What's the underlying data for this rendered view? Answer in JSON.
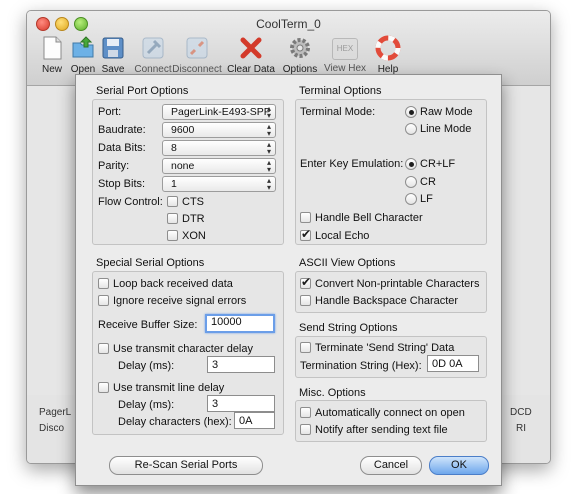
{
  "window": {
    "title": "CoolTerm_0",
    "toolbar": [
      {
        "id": "new",
        "label": "New",
        "icon": "new-document-icon"
      },
      {
        "id": "open",
        "label": "Open",
        "icon": "open-folder-icon"
      },
      {
        "id": "save",
        "label": "Save",
        "icon": "save-disk-icon"
      },
      {
        "id": "connect",
        "label": "Connect",
        "icon": "connect-plug-icon"
      },
      {
        "id": "disconnect",
        "label": "Disconnect",
        "icon": "disconnect-plug-icon"
      },
      {
        "id": "clear",
        "label": "Clear Data",
        "icon": "clear-x-icon"
      },
      {
        "id": "options",
        "label": "Options",
        "icon": "gear-icon"
      },
      {
        "id": "hex",
        "label": "View Hex",
        "icon": "hex-icon",
        "glyph": "HEX"
      },
      {
        "id": "help",
        "label": "Help",
        "icon": "lifebuoy-icon"
      }
    ],
    "status": {
      "port_left_top": "PagerL",
      "port_left_bottom": "Disco",
      "right_top": "DCD",
      "right_bottom": "RI"
    }
  },
  "dialog": {
    "serial": {
      "title": "Serial Port Options",
      "port_label": "Port:",
      "port_value": "PagerLink-E493-SPP",
      "baud_label": "Baudrate:",
      "baud_value": "9600",
      "databits_label": "Data Bits:",
      "databits_value": "8",
      "parity_label": "Parity:",
      "parity_value": "none",
      "stopbits_label": "Stop Bits:",
      "stopbits_value": "1",
      "flow_label": "Flow Control:",
      "cts_label": "CTS",
      "dtr_label": "DTR",
      "xon_label": "XON",
      "arrows": "▴▾"
    },
    "terminal": {
      "title": "Terminal Options",
      "mode_label": "Terminal Mode:",
      "raw_label": "Raw Mode",
      "line_label": "Line Mode",
      "enter_label": "Enter Key Emulation:",
      "crlf_label": "CR+LF",
      "cr_label": "CR",
      "lf_label": "LF",
      "bell_label": "Handle Bell Character",
      "echo_label": "Local Echo"
    },
    "special": {
      "title": "Special Serial Options",
      "loopback_label": "Loop back received data",
      "ignore_label": "Ignore receive signal errors",
      "buffer_label": "Receive Buffer Size:",
      "buffer_value": "10000",
      "char_delay_label": "Use transmit character delay",
      "delay_label": "Delay (ms):",
      "char_delay_value": "3",
      "line_delay_label": "Use transmit line delay",
      "line_delay_ms_label": "Delay (ms):",
      "line_delay_value": "3",
      "delay_chars_label": "Delay characters (hex):",
      "delay_chars_value": "0A"
    },
    "ascii": {
      "title": "ASCII View Options",
      "convert_label": "Convert Non-printable Characters",
      "backspace_label": "Handle Backspace Character"
    },
    "send": {
      "title": "Send String Options",
      "terminate_label": "Terminate 'Send String' Data",
      "term_string_label": "Termination String (Hex):",
      "term_string_value": "0D 0A"
    },
    "misc": {
      "title": "Misc. Options",
      "auto_label": "Automatically connect on open",
      "notify_label": "Notify after sending text file"
    },
    "buttons": {
      "rescan": "Re-Scan Serial Ports",
      "cancel": "Cancel",
      "ok": "OK"
    }
  }
}
